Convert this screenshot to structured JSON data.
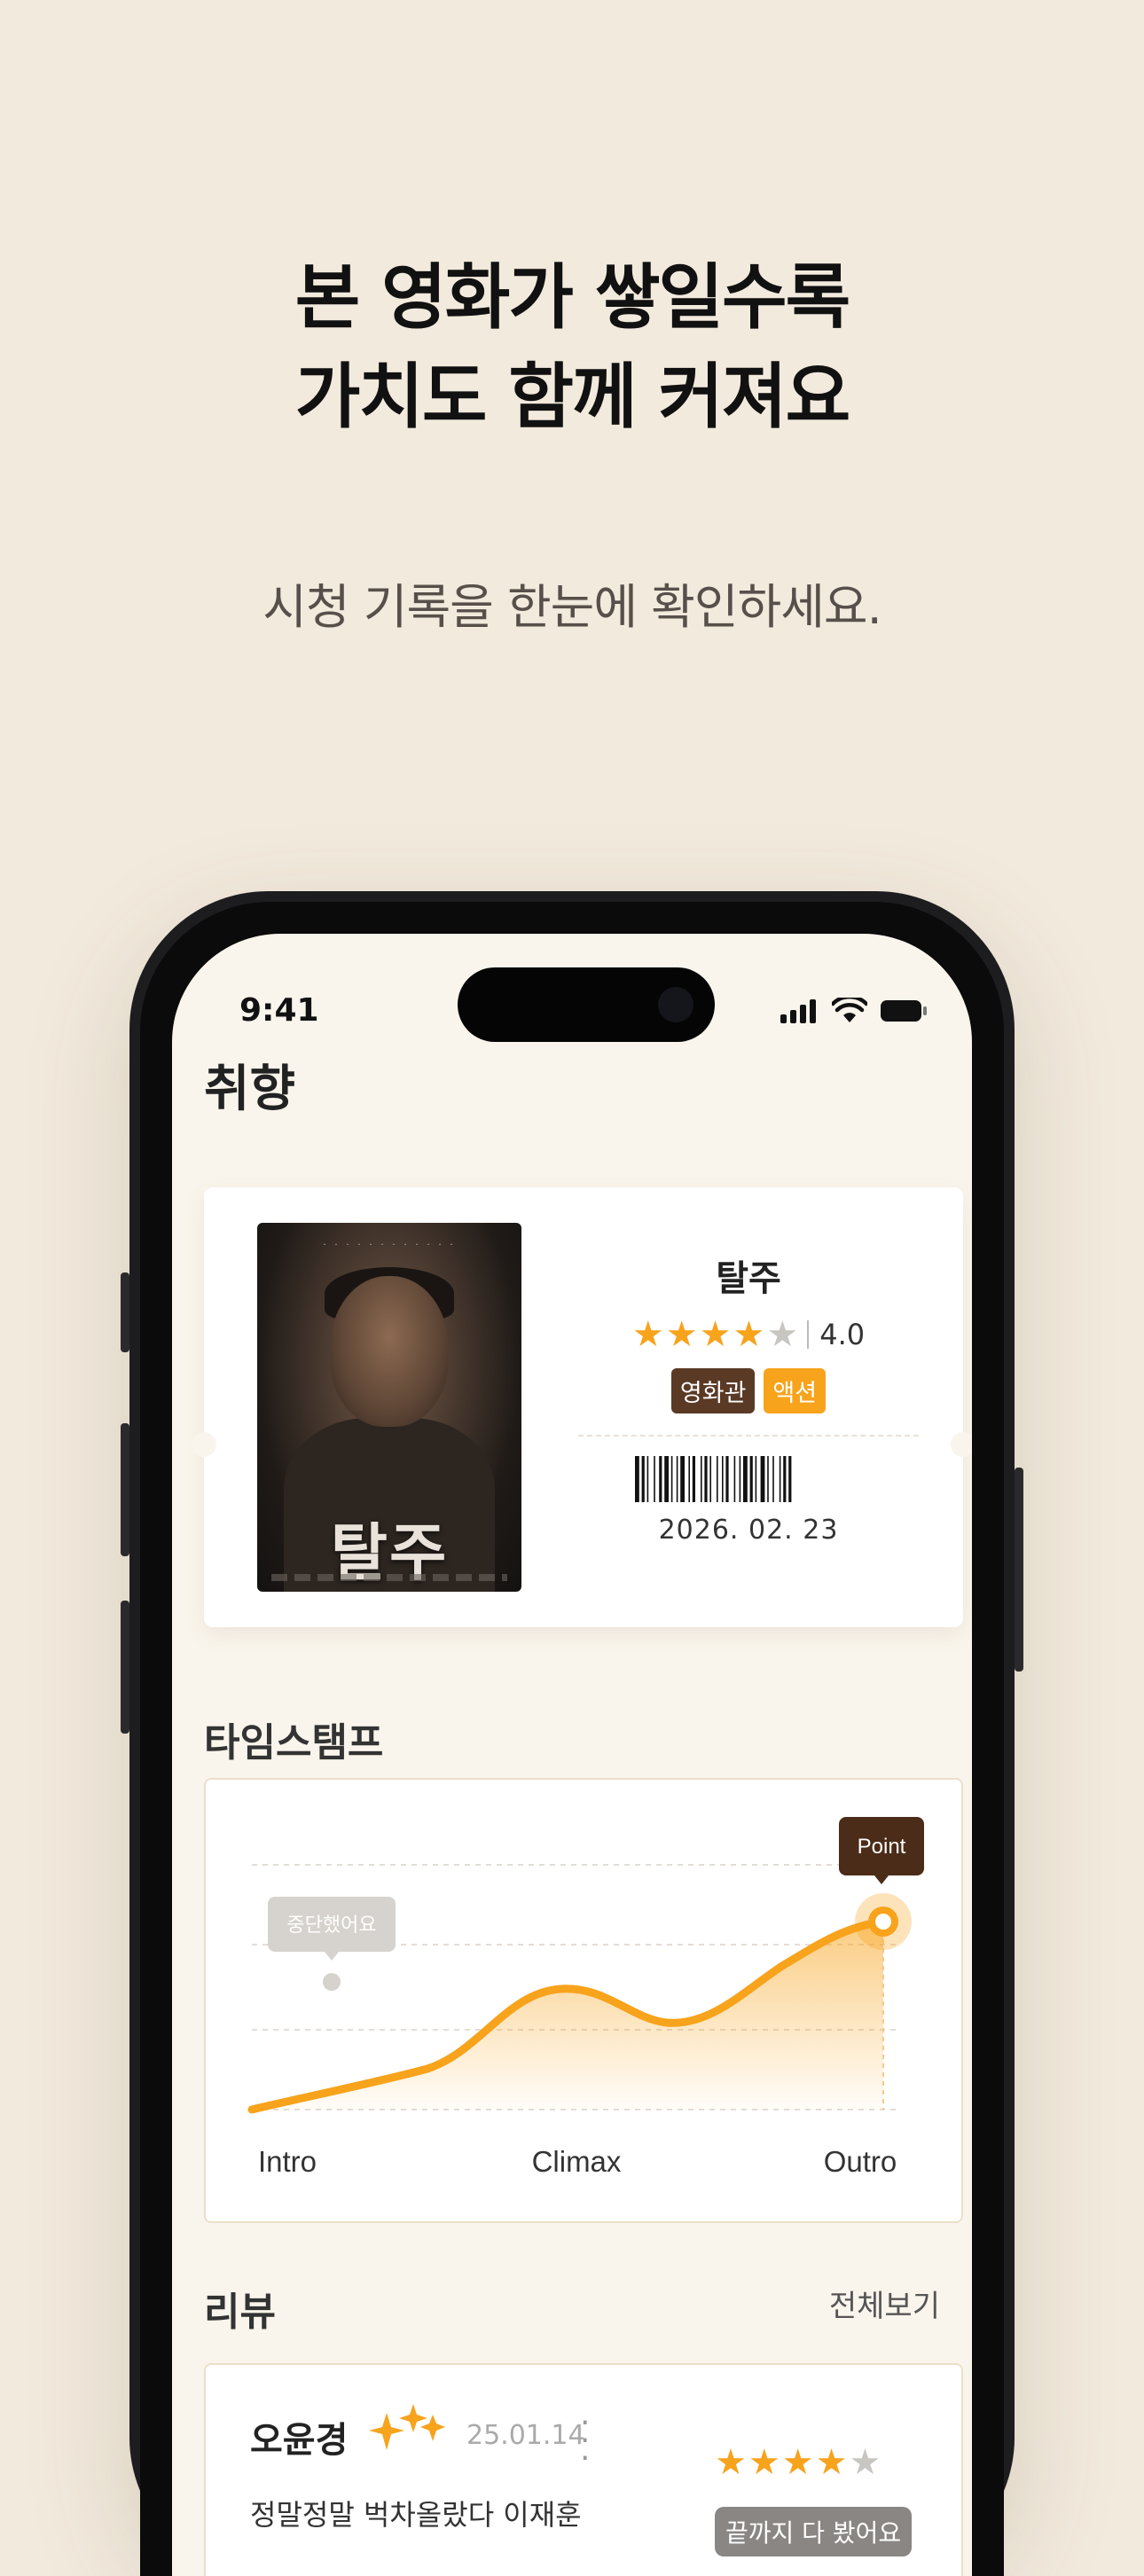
{
  "promo": {
    "headline_line1": "본 영화가 쌓일수록",
    "headline_line2": "가치도 함께 커져요",
    "subline": "시청 기록을 한눈에 확인하세요."
  },
  "status_bar": {
    "time": "9:41",
    "icons": [
      "signal-icon",
      "wifi-icon",
      "battery-icon"
    ]
  },
  "page": {
    "title": "취향"
  },
  "ticket": {
    "poster_title": "탈주",
    "movie_title": "탈주",
    "rating": {
      "stars_filled": 4,
      "stars_total": 5,
      "value": "4.0"
    },
    "tags": [
      "영화관",
      "액션"
    ],
    "date": "2026. 02. 23"
  },
  "timestamp": {
    "section_title": "타임스탬프",
    "labels": [
      "Intro",
      "Climax",
      "Outro"
    ],
    "stop_tooltip": "중단했어요",
    "point_tooltip": "Point",
    "colors": {
      "line": "#f7a31c",
      "tooltip_dark": "#4a2c18",
      "tooltip_gray": "#cfcbc6"
    }
  },
  "reviews": {
    "section_title": "리뷰",
    "see_all": "전체보기",
    "items": [
      {
        "name": "오윤경",
        "date": "25.01.14",
        "text": "정말정말 벅차올랐다 이재훈",
        "stars_filled": 4,
        "badge": "끝까지 다 봤어요"
      }
    ]
  },
  "colors": {
    "background": "#f2eadd",
    "accent": "#f7a31c",
    "brown": "#5a3a25"
  }
}
